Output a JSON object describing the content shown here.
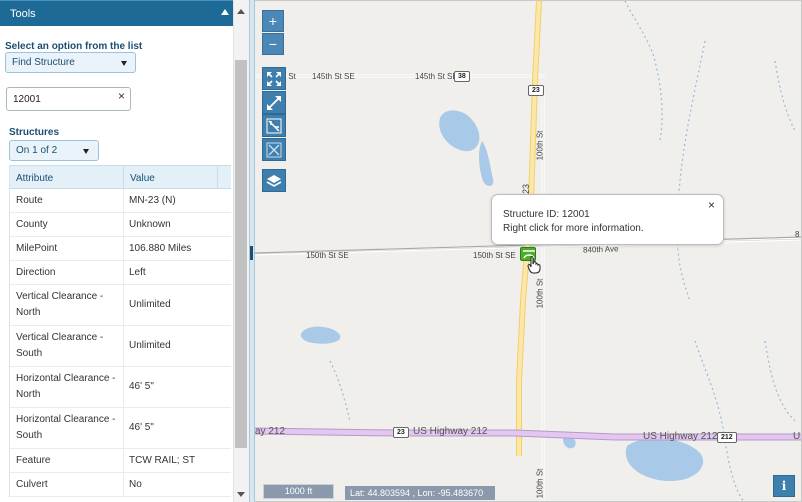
{
  "sidebar": {
    "title": "Tools",
    "option_label": "Select an option from the list",
    "option_selected": "Find Structure",
    "search_value": "12001",
    "search_clear": "×",
    "structures_label": "Structures",
    "structures_selected": "On 1 of 2"
  },
  "table": {
    "headers": [
      "Attribute",
      "Value"
    ],
    "rows": [
      {
        "attribute": "Route",
        "value": "MN-23 (N)"
      },
      {
        "attribute": "County",
        "value": "Unknown"
      },
      {
        "attribute": "MilePoint",
        "value": "106.880 Miles"
      },
      {
        "attribute": "Direction",
        "value": "Left"
      },
      {
        "attribute": "Vertical Clearance - North",
        "value": "Unlimited"
      },
      {
        "attribute": "Vertical Clearance - South",
        "value": "Unlimited"
      },
      {
        "attribute": "Horizontal Clearance - North",
        "value": "46' 5\""
      },
      {
        "attribute": "Horizontal Clearance - South",
        "value": "46' 5\""
      },
      {
        "attribute": "Feature",
        "value": "TCW RAIL; ST"
      },
      {
        "attribute": "Culvert",
        "value": "No"
      }
    ]
  },
  "map": {
    "zoom_in": "+",
    "zoom_out": "−",
    "road_labels": {
      "st145_left": "k St",
      "st145_a": "145th St SE",
      "st145_b": "145th St SE",
      "st150_left": "150th St SE",
      "st150_right": "150th St SE",
      "ave840": "840th Ave",
      "edge_8": "8",
      "st100_top": "100th St",
      "st100_mid": "100th St",
      "st100_bottom": "100th St",
      "hw23_vertical": "23",
      "us212_left": "ay 212",
      "us212_mid": "US Highway 212",
      "us212_right": "US Highway 212",
      "us212_edge": "U"
    },
    "shields": {
      "s38": "38",
      "s23_top": "23",
      "s23_bottom": "23",
      "s212": "212"
    },
    "popup": {
      "line1": "Structure ID: 12001",
      "line2": "Right click for more information.",
      "close": "×"
    },
    "scale": "1000 ft",
    "coordinates": "Lat: 44.803594 , Lon: -95.483670",
    "info": "i"
  }
}
